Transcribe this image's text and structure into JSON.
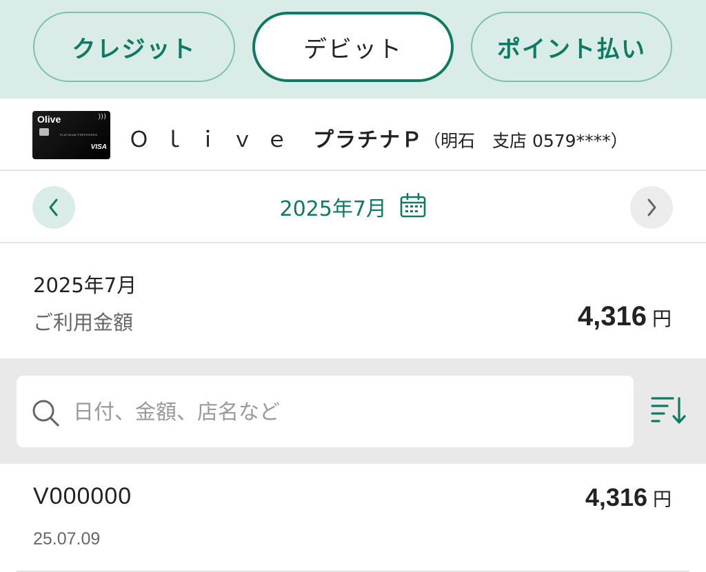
{
  "tabs": [
    {
      "label": "クレジット",
      "active": false
    },
    {
      "label": "デビット",
      "active": true
    },
    {
      "label": "ポイント払い",
      "active": false
    }
  ],
  "card": {
    "image": {
      "brand": "Olive",
      "tier_text": "PLATINUM PREFERRED",
      "network": "VISA"
    },
    "name": "Ｏｌｉｖｅ",
    "tier": "プラチナＰ",
    "branch": "（明石　支店 0579****）"
  },
  "month_nav": {
    "label": "2025年7月",
    "prev_icon": "chevron-left-icon",
    "next_icon": "chevron-right-icon",
    "calendar_icon": "calendar-icon"
  },
  "summary": {
    "month": "2025年7月",
    "label": "ご利用金額",
    "amount": "4,316",
    "unit": "円"
  },
  "search": {
    "placeholder": "日付、金額、店名など",
    "value": "",
    "sort_icon": "sort-icon"
  },
  "transactions": [
    {
      "name": "V000000",
      "date": "25.07.09",
      "amount": "4,316",
      "unit": "円"
    }
  ],
  "colors": {
    "accent": "#0e7a62",
    "tab_background": "#d9ece8",
    "tab_border": "#7fc0ad",
    "search_background": "#e9e9e9",
    "divider": "#e2e2e2"
  }
}
